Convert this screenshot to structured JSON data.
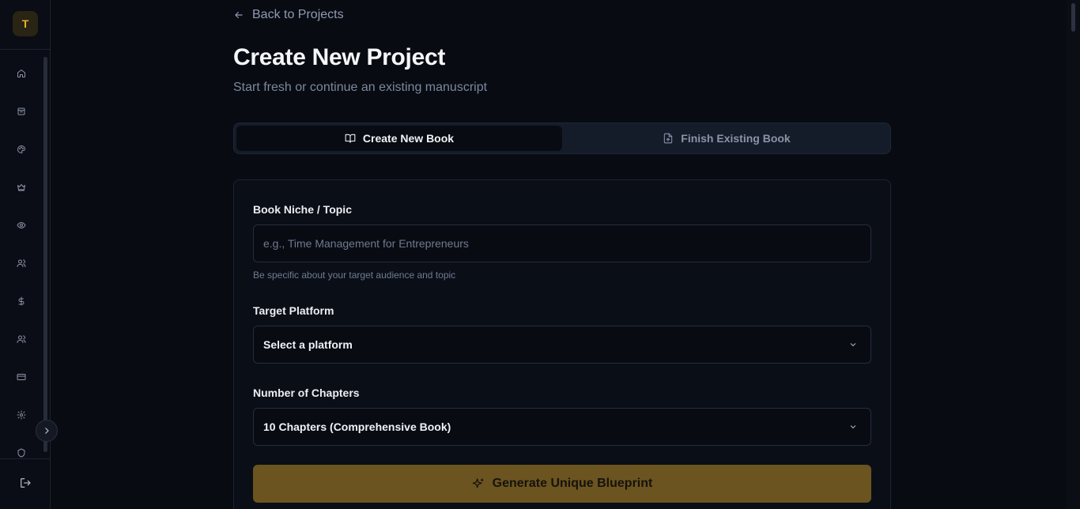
{
  "sidebar": {
    "logo_letter": "T",
    "items": [
      {
        "name": "home-icon"
      },
      {
        "name": "box-icon"
      },
      {
        "name": "palette-icon"
      },
      {
        "name": "crown-icon"
      },
      {
        "name": "eye-icon"
      },
      {
        "name": "users-icon"
      },
      {
        "name": "dollar-icon"
      },
      {
        "name": "team-icon"
      },
      {
        "name": "credit-card-icon"
      },
      {
        "name": "gear-icon"
      },
      {
        "name": "shield-icon"
      }
    ],
    "logout_icon": "logout-icon",
    "collapse_icon": "chevron-right-icon"
  },
  "header": {
    "back_label": "Back to Projects",
    "title": "Create New Project",
    "subtitle": "Start fresh or continue an existing manuscript"
  },
  "tabs": [
    {
      "label": "Create New Book",
      "icon": "book-open-icon",
      "active": true
    },
    {
      "label": "Finish Existing Book",
      "icon": "file-upload-icon",
      "active": false
    }
  ],
  "form": {
    "niche": {
      "label": "Book Niche / Topic",
      "placeholder": "e.g., Time Management for Entrepreneurs",
      "value": "",
      "hint": "Be specific about your target audience and topic"
    },
    "platform": {
      "label": "Target Platform",
      "value": "Select a platform"
    },
    "chapters": {
      "label": "Number of Chapters",
      "value": "10 Chapters (Comprehensive Book)"
    },
    "submit_label": "Generate Unique Blueprint"
  },
  "colors": {
    "accent": "#e2b32f",
    "button_bg": "#6b5420",
    "background": "#080b12"
  }
}
